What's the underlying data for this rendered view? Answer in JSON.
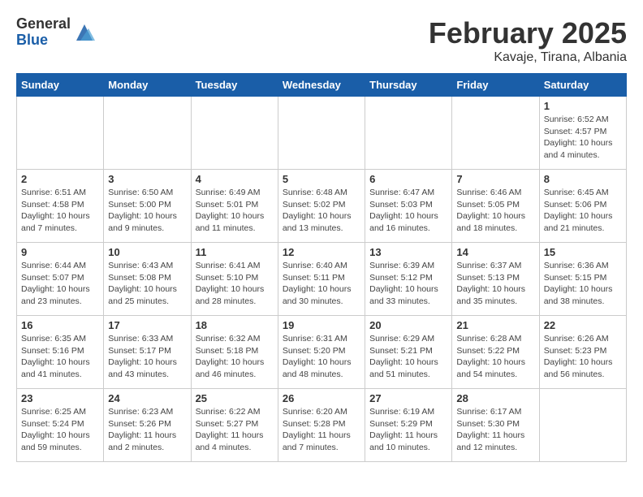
{
  "header": {
    "logo_general": "General",
    "logo_blue": "Blue",
    "month": "February 2025",
    "location": "Kavaje, Tirana, Albania"
  },
  "days_of_week": [
    "Sunday",
    "Monday",
    "Tuesday",
    "Wednesday",
    "Thursday",
    "Friday",
    "Saturday"
  ],
  "weeks": [
    [
      {
        "day": "",
        "info": ""
      },
      {
        "day": "",
        "info": ""
      },
      {
        "day": "",
        "info": ""
      },
      {
        "day": "",
        "info": ""
      },
      {
        "day": "",
        "info": ""
      },
      {
        "day": "",
        "info": ""
      },
      {
        "day": "1",
        "info": "Sunrise: 6:52 AM\nSunset: 4:57 PM\nDaylight: 10 hours and 4 minutes."
      }
    ],
    [
      {
        "day": "2",
        "info": "Sunrise: 6:51 AM\nSunset: 4:58 PM\nDaylight: 10 hours and 7 minutes."
      },
      {
        "day": "3",
        "info": "Sunrise: 6:50 AM\nSunset: 5:00 PM\nDaylight: 10 hours and 9 minutes."
      },
      {
        "day": "4",
        "info": "Sunrise: 6:49 AM\nSunset: 5:01 PM\nDaylight: 10 hours and 11 minutes."
      },
      {
        "day": "5",
        "info": "Sunrise: 6:48 AM\nSunset: 5:02 PM\nDaylight: 10 hours and 13 minutes."
      },
      {
        "day": "6",
        "info": "Sunrise: 6:47 AM\nSunset: 5:03 PM\nDaylight: 10 hours and 16 minutes."
      },
      {
        "day": "7",
        "info": "Sunrise: 6:46 AM\nSunset: 5:05 PM\nDaylight: 10 hours and 18 minutes."
      },
      {
        "day": "8",
        "info": "Sunrise: 6:45 AM\nSunset: 5:06 PM\nDaylight: 10 hours and 21 minutes."
      }
    ],
    [
      {
        "day": "9",
        "info": "Sunrise: 6:44 AM\nSunset: 5:07 PM\nDaylight: 10 hours and 23 minutes."
      },
      {
        "day": "10",
        "info": "Sunrise: 6:43 AM\nSunset: 5:08 PM\nDaylight: 10 hours and 25 minutes."
      },
      {
        "day": "11",
        "info": "Sunrise: 6:41 AM\nSunset: 5:10 PM\nDaylight: 10 hours and 28 minutes."
      },
      {
        "day": "12",
        "info": "Sunrise: 6:40 AM\nSunset: 5:11 PM\nDaylight: 10 hours and 30 minutes."
      },
      {
        "day": "13",
        "info": "Sunrise: 6:39 AM\nSunset: 5:12 PM\nDaylight: 10 hours and 33 minutes."
      },
      {
        "day": "14",
        "info": "Sunrise: 6:37 AM\nSunset: 5:13 PM\nDaylight: 10 hours and 35 minutes."
      },
      {
        "day": "15",
        "info": "Sunrise: 6:36 AM\nSunset: 5:15 PM\nDaylight: 10 hours and 38 minutes."
      }
    ],
    [
      {
        "day": "16",
        "info": "Sunrise: 6:35 AM\nSunset: 5:16 PM\nDaylight: 10 hours and 41 minutes."
      },
      {
        "day": "17",
        "info": "Sunrise: 6:33 AM\nSunset: 5:17 PM\nDaylight: 10 hours and 43 minutes."
      },
      {
        "day": "18",
        "info": "Sunrise: 6:32 AM\nSunset: 5:18 PM\nDaylight: 10 hours and 46 minutes."
      },
      {
        "day": "19",
        "info": "Sunrise: 6:31 AM\nSunset: 5:20 PM\nDaylight: 10 hours and 48 minutes."
      },
      {
        "day": "20",
        "info": "Sunrise: 6:29 AM\nSunset: 5:21 PM\nDaylight: 10 hours and 51 minutes."
      },
      {
        "day": "21",
        "info": "Sunrise: 6:28 AM\nSunset: 5:22 PM\nDaylight: 10 hours and 54 minutes."
      },
      {
        "day": "22",
        "info": "Sunrise: 6:26 AM\nSunset: 5:23 PM\nDaylight: 10 hours and 56 minutes."
      }
    ],
    [
      {
        "day": "23",
        "info": "Sunrise: 6:25 AM\nSunset: 5:24 PM\nDaylight: 10 hours and 59 minutes."
      },
      {
        "day": "24",
        "info": "Sunrise: 6:23 AM\nSunset: 5:26 PM\nDaylight: 11 hours and 2 minutes."
      },
      {
        "day": "25",
        "info": "Sunrise: 6:22 AM\nSunset: 5:27 PM\nDaylight: 11 hours and 4 minutes."
      },
      {
        "day": "26",
        "info": "Sunrise: 6:20 AM\nSunset: 5:28 PM\nDaylight: 11 hours and 7 minutes."
      },
      {
        "day": "27",
        "info": "Sunrise: 6:19 AM\nSunset: 5:29 PM\nDaylight: 11 hours and 10 minutes."
      },
      {
        "day": "28",
        "info": "Sunrise: 6:17 AM\nSunset: 5:30 PM\nDaylight: 11 hours and 12 minutes."
      },
      {
        "day": "",
        "info": ""
      }
    ]
  ]
}
